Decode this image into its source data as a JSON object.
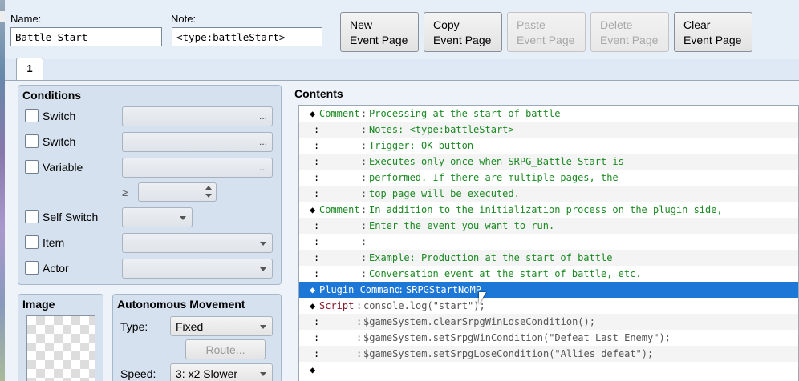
{
  "header": {
    "name_label": "Name:",
    "name_value": "Battle Start",
    "note_label": "Note:",
    "note_value": "<type:battleStart>",
    "buttons": [
      {
        "line1": "New",
        "line2": "Event Page"
      },
      {
        "line1": "Copy",
        "line2": "Event Page"
      },
      {
        "line1": "Paste",
        "line2": "Event Page"
      },
      {
        "line1": "Delete",
        "line2": "Event Page"
      },
      {
        "line1": "Clear",
        "line2": "Event Page"
      }
    ]
  },
  "tabs": [
    {
      "label": "1"
    }
  ],
  "conditions": {
    "title": "Conditions",
    "items": [
      {
        "label": "Switch"
      },
      {
        "label": "Switch"
      },
      {
        "label": "Variable"
      },
      {
        "label": "Self Switch"
      },
      {
        "label": "Item"
      },
      {
        "label": "Actor"
      }
    ],
    "ge_symbol": "≥",
    "ellipsis": "..."
  },
  "image": {
    "title": "Image"
  },
  "movement": {
    "title": "Autonomous Movement",
    "type_label": "Type:",
    "type_value": "Fixed",
    "route_label": "Route...",
    "speed_label": "Speed:",
    "speed_value": "3: x2 Slower"
  },
  "contents": {
    "title": "Contents",
    "rows": [
      {
        "prefix": "◆",
        "kw": "Comment",
        "sep": ":",
        "text": "Processing at the start of battle",
        "kind": "comment"
      },
      {
        "prefix": ":",
        "kw": "",
        "sep": ":",
        "text": "Notes: <type:battleStart>",
        "kind": "comment"
      },
      {
        "prefix": ":",
        "kw": "",
        "sep": ":",
        "text": "Trigger: OK button",
        "kind": "comment"
      },
      {
        "prefix": ":",
        "kw": "",
        "sep": ":",
        "text": "Executes only once when SRPG_Battle Start is",
        "kind": "comment"
      },
      {
        "prefix": ":",
        "kw": "",
        "sep": ":",
        "text": "performed. If there are multiple pages, the",
        "kind": "comment"
      },
      {
        "prefix": ":",
        "kw": "",
        "sep": ":",
        "text": "top page will be executed.",
        "kind": "comment"
      },
      {
        "prefix": "◆",
        "kw": "Comment",
        "sep": ":",
        "text": "In addition to the initialization process on the plugin side,",
        "kind": "comment"
      },
      {
        "prefix": ":",
        "kw": "",
        "sep": ":",
        "text": "Enter the event you want to run.",
        "kind": "comment"
      },
      {
        "prefix": ":",
        "kw": "",
        "sep": ":",
        "text": "",
        "kind": "comment"
      },
      {
        "prefix": ":",
        "kw": "",
        "sep": ":",
        "text": "Example: Production at the start of battle",
        "kind": "comment"
      },
      {
        "prefix": ":",
        "kw": "",
        "sep": ":",
        "text": "Conversation event at the start of battle, etc.",
        "kind": "comment"
      },
      {
        "prefix": "◆",
        "kw": "Plugin Command",
        "sep": ":",
        "text": "SRPGStartNoMP",
        "kind": "selected"
      },
      {
        "prefix": "◆",
        "kw": "Script",
        "sep": ":",
        "text": "console.log(\"start\");",
        "kind": "script"
      },
      {
        "prefix": ":",
        "kw": "",
        "sep": ":",
        "text": "$gameSystem.clearSrpgWinLoseCondition();",
        "kind": "script"
      },
      {
        "prefix": ":",
        "kw": "",
        "sep": ":",
        "text": "$gameSystem.setSrpgWinCondition(\"Defeat Last Enemy\");",
        "kind": "script"
      },
      {
        "prefix": ":",
        "kw": "",
        "sep": ":",
        "text": "$gameSystem.setSrpgLoseCondition(\"Allies defeat\");",
        "kind": "script"
      },
      {
        "prefix": "◆",
        "kw": "",
        "sep": "",
        "text": "",
        "kind": "end"
      }
    ]
  }
}
